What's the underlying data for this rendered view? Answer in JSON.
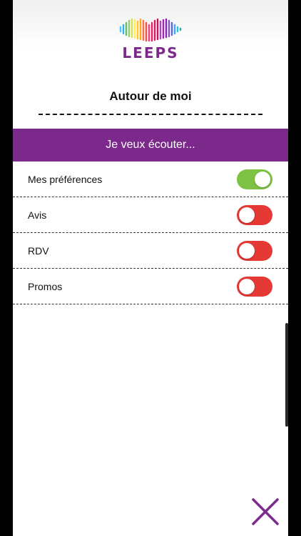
{
  "app": {
    "logo_text": "LEEPS"
  },
  "header": {
    "title": "Autour de moi"
  },
  "banner": {
    "label": "Je veux écouter..."
  },
  "preferences": [
    {
      "label": "Mes préférences",
      "enabled": true
    },
    {
      "label": "Avis",
      "enabled": false
    },
    {
      "label": "RDV",
      "enabled": false
    },
    {
      "label": "Promos",
      "enabled": false
    }
  ],
  "colors": {
    "brand": "#7b2a8c",
    "toggle_on": "#7dc242",
    "toggle_off": "#e53935"
  },
  "icons": {
    "logo": "sound-wave-heart-icon",
    "close": "close-icon"
  }
}
